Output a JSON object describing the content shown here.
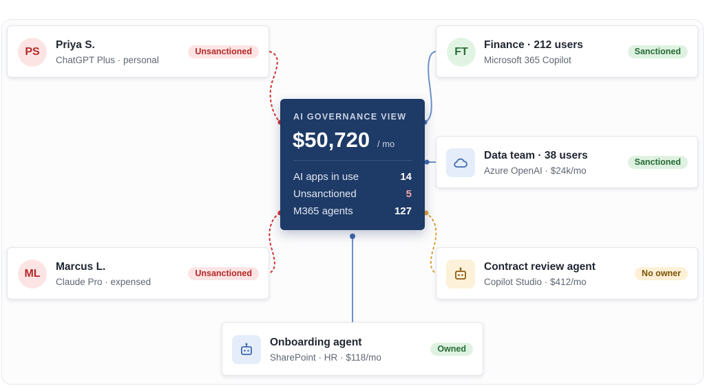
{
  "hub": {
    "label": "AI GOVERNANCE VIEW",
    "amount": "$50,720",
    "period": "/ mo",
    "stats": [
      {
        "label": "AI apps in use",
        "value": "14"
      },
      {
        "label": "Unsanctioned",
        "value": "5"
      },
      {
        "label": "M365 agents",
        "value": "127"
      }
    ]
  },
  "cards": {
    "priya": {
      "initials": "PS",
      "title": "Priya S.",
      "subtitle": "ChatGPT Plus · personal",
      "badge": "Unsanctioned"
    },
    "marcus": {
      "initials": "ML",
      "title": "Marcus L.",
      "subtitle": "Claude Pro · expensed",
      "badge": "Unsanctioned"
    },
    "finance": {
      "initials": "FT",
      "title": "Finance · 212 users",
      "subtitle": "Microsoft 365 Copilot",
      "badge": "Sanctioned"
    },
    "data_team": {
      "icon": "cloud-icon",
      "title": "Data team · 38 users",
      "subtitle": "Azure OpenAI · $24k/mo",
      "badge": "Sanctioned"
    },
    "contract": {
      "icon": "robot-icon",
      "title": "Contract review agent",
      "subtitle": "Copilot Studio · $412/mo",
      "badge": "No owner"
    },
    "onboarding": {
      "icon": "robot-icon",
      "title": "Onboarding agent",
      "subtitle": "SharePoint · HR · $118/mo",
      "badge": "Owned"
    }
  },
  "colors": {
    "hub_bg": "#1e3a66",
    "unsanctioned": "#d0302f",
    "sanctioned_line": "#6b8fc9",
    "no_owner": "#d9a03a"
  }
}
